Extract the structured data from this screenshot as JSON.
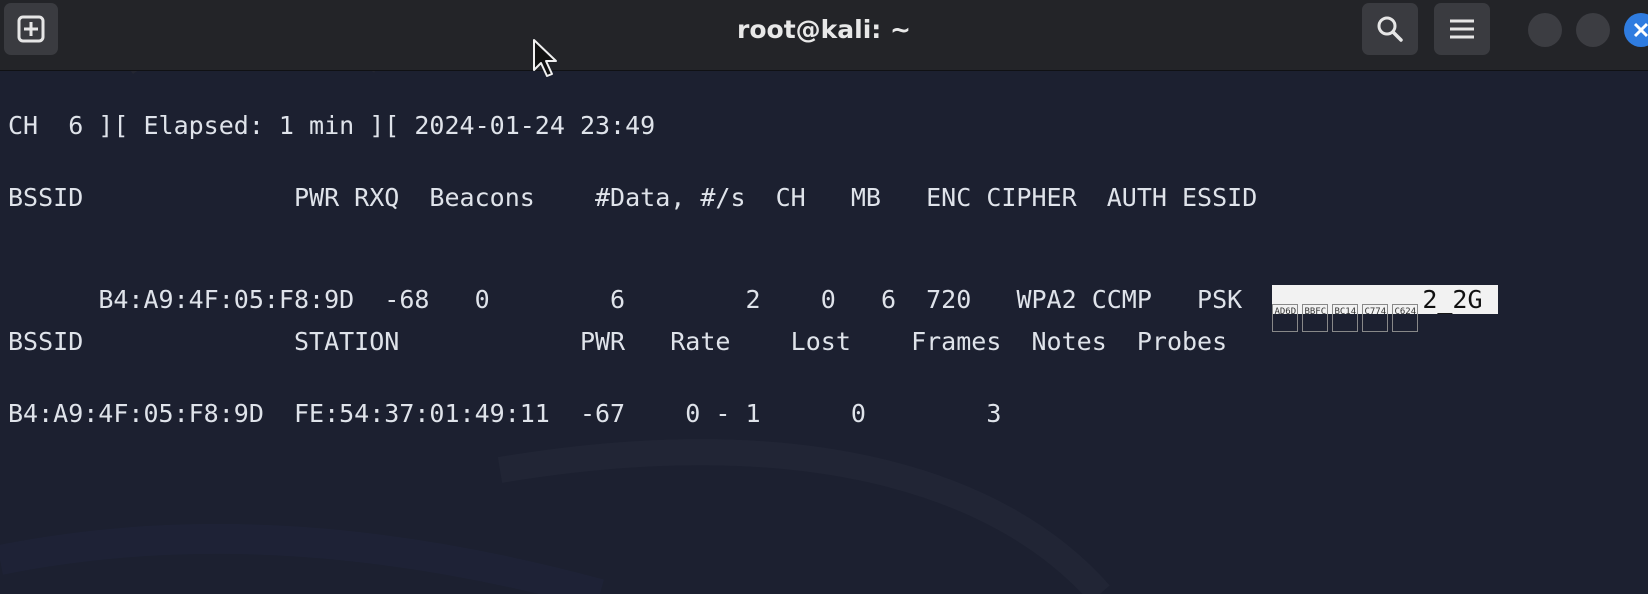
{
  "window": {
    "title": "root@kali: ~",
    "accent_color": "#2f7ce0",
    "background_color": "#1c2030",
    "titlebar_color": "#232428"
  },
  "titlebar": {
    "new_tab_icon": "plus-square-icon",
    "search_icon": "search-icon",
    "menu_icon": "hamburger-menu-icon",
    "minimize_icon": "minimize-icon",
    "maximize_icon": "maximize-icon",
    "close_icon": "close-icon"
  },
  "terminal": {
    "status_line": "CH  6 ][ Elapsed: 1 min ][ 2024-01-24 23:49",
    "ap_header": "BSSID              PWR RXQ  Beacons    #Data, #/s  CH   MB   ENC CIPHER  AUTH ESSID",
    "ap_rows": [
      {
        "prefix": "B4:A9:4F:05:F8:9D  -68   0        6        2    0   6  720   WPA2 CCMP   PSK  ",
        "essid_glyphs": [
          "AD6D",
          "BBFC",
          "BC14",
          "C774",
          "C624"
        ],
        "essid_suffix": "2_2G "
      }
    ],
    "station_header": "BSSID              STATION            PWR   Rate    Lost    Frames  Notes  Probes",
    "station_rows": [
      "B4:A9:4F:05:F8:9D  FE:54:37:01:49:11  -67    0 - 1      0        3"
    ]
  }
}
